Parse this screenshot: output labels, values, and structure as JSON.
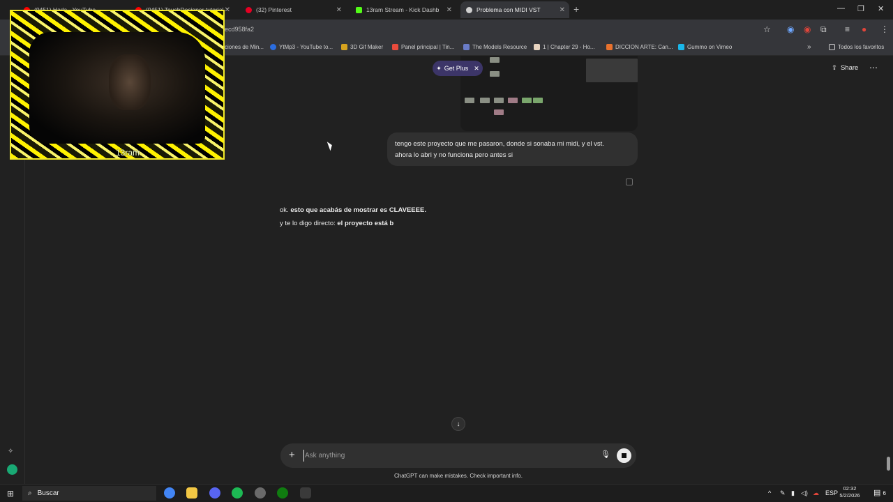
{
  "browser": {
    "tabs": [
      {
        "label": "(9451) Hada - YouTube",
        "color": "#ff0000"
      },
      {
        "label": "(9451) TouchDesigner tutorial",
        "color": "#ff0000"
      },
      {
        "label": "(32) Pinterest",
        "color": "#e60023"
      },
      {
        "label": "13ram Stream - Kick Dashb",
        "color": "#53fc18"
      },
      {
        "label": "Problema con MIDI VST",
        "color": "#d0d0d0"
      }
    ],
    "url_fragment": "ecd958fa2",
    "bookmarks": [
      {
        "label": "ciones de Min...",
        "color": "#777777"
      },
      {
        "label": "YtMp3 - YouTube to...",
        "color": "#2b6de0"
      },
      {
        "label": "3D Gif Maker",
        "color": "#d6a21e"
      },
      {
        "label": "Panel principal | Tin...",
        "color": "#e94b3c"
      },
      {
        "label": "The Models Resource",
        "color": "#6a7cc7"
      },
      {
        "label": "1 | Chapter 29 - Ho...",
        "color": "#e8d4c0"
      },
      {
        "label": "DICCION ARTE: Can...",
        "color": "#e8712d"
      },
      {
        "label": "Gummo on Vimeo",
        "color": "#1ab7ea"
      }
    ],
    "favorites_label": "Todos los favoritos"
  },
  "chat": {
    "get_plus": "Get Plus",
    "share": "Share",
    "user_message_line1": "tengo este proyecto que me pasaron, donde si sonaba mi midi, y el vst.",
    "user_message_line2": "ahora lo abri y no funciona pero antes si",
    "assistant_line1_plain": "ok. ",
    "assistant_line1_bold": "esto que acabás de mostrar es CLAVEEEE.",
    "assistant_line2_plain": "y te lo digo directo: ",
    "assistant_line2_bold": "el proyecto está b",
    "input_placeholder": "Ask anything",
    "disclaimer": "ChatGPT can make mistakes. Check important info."
  },
  "webcam": {
    "overlay_label": "13ram"
  },
  "taskbar": {
    "search_label": "Buscar",
    "language": "ESP",
    "time": "02:32",
    "date": "5/2/2026",
    "notification_count": "6"
  },
  "accent_colors": {
    "get_plus_bg": "#3c3568",
    "user_avatar": "#19a974"
  }
}
